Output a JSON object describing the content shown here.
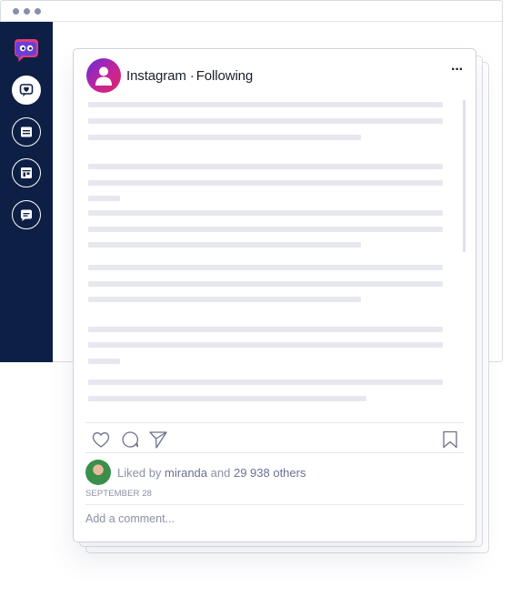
{
  "browser": {
    "dots": [
      "dot",
      "dot",
      "dot"
    ]
  },
  "sidebar": {
    "logo": "chat-bot-logo-icon",
    "items": [
      {
        "icon": "heart-chat-icon",
        "active": true
      },
      {
        "icon": "feed-icon",
        "active": false
      },
      {
        "icon": "store-icon",
        "active": false
      },
      {
        "icon": "message-icon",
        "active": false
      }
    ]
  },
  "post": {
    "account": "Instagram",
    "separator": "·",
    "status": "Following",
    "more": "···",
    "likes": {
      "prefix": "Liked by",
      "user": "miranda",
      "and": "and",
      "others": "29 938 others"
    },
    "date": "SEPTEMBER 28",
    "comment_placeholder": "Add a comment..."
  },
  "colors": {
    "sidebar": "#0e1f45",
    "placeholder_line": "#e7e8ef",
    "muted_text": "#8b90a5",
    "avatar_gradient": [
      "#6a2bd9",
      "#c2259b",
      "#e0245e"
    ]
  }
}
